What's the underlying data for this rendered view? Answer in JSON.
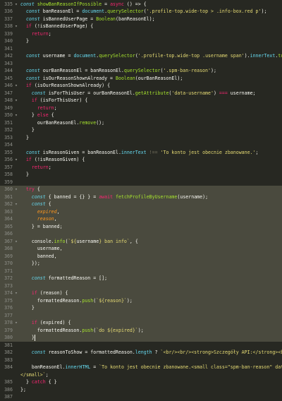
{
  "editor": {
    "theme_colors": {
      "background": "#272822",
      "highlight": "#4a4a3e",
      "keyword": "#f92672",
      "string": "#e6db74",
      "function": "#a6e22e",
      "property": "#66d9ef",
      "number": "#ae81ff",
      "comment": "#75715e"
    },
    "lines": [
      {
        "n": "335",
        "fold": "▾",
        "tokens": [
          [
            "t-dec",
            "const "
          ],
          [
            "t-fn",
            "showBanReasonIfPossible"
          ],
          [
            "t-punc",
            " = "
          ],
          [
            "t-kw",
            "async"
          ],
          [
            "t-punc",
            " () => {"
          ]
        ]
      },
      {
        "n": "336",
        "fold": "",
        "tokens": [
          [
            "t-dec",
            "  const "
          ],
          [
            "t-var",
            "banReasonEl"
          ],
          [
            "t-punc",
            " = "
          ],
          [
            "t-prop",
            "document"
          ],
          [
            "t-punc",
            "."
          ],
          [
            "t-fn",
            "querySelector"
          ],
          [
            "t-punc",
            "("
          ],
          [
            "t-str",
            "'.profile-top.wide-top > .info-box.red p'"
          ],
          [
            "t-punc",
            ");"
          ]
        ]
      },
      {
        "n": "337",
        "fold": "",
        "tokens": [
          [
            "t-dec",
            "  const "
          ],
          [
            "t-var",
            "isBannedUserPage"
          ],
          [
            "t-punc",
            " = "
          ],
          [
            "t-fn",
            "Boolean"
          ],
          [
            "t-punc",
            "(banReasonEl);"
          ]
        ]
      },
      {
        "n": "338",
        "fold": "▾",
        "tokens": [
          [
            "t-kw",
            "  if"
          ],
          [
            "t-punc",
            " (!isBannedUserPage) {"
          ]
        ]
      },
      {
        "n": "339",
        "fold": "",
        "tokens": [
          [
            "t-kw",
            "    return"
          ],
          [
            "t-punc",
            ";"
          ]
        ]
      },
      {
        "n": "340",
        "fold": "",
        "tokens": [
          [
            "t-punc",
            "  }"
          ]
        ]
      },
      {
        "n": "341",
        "fold": "",
        "tokens": []
      },
      {
        "n": "342",
        "fold": "",
        "tokens": [
          [
            "t-dec",
            "  const "
          ],
          [
            "t-var",
            "username"
          ],
          [
            "t-punc",
            " = "
          ],
          [
            "t-prop",
            "document"
          ],
          [
            "t-punc",
            "."
          ],
          [
            "t-fn",
            "querySelector"
          ],
          [
            "t-punc",
            "("
          ],
          [
            "t-str",
            "'.profile-top.wide-top .username span'"
          ],
          [
            "t-punc",
            ")."
          ],
          [
            "t-prop",
            "innerText"
          ],
          [
            "t-punc",
            "."
          ],
          [
            "t-fn",
            "trim"
          ],
          [
            "t-punc",
            "();"
          ]
        ]
      },
      {
        "n": "343",
        "fold": "",
        "tokens": []
      },
      {
        "n": "344",
        "fold": "",
        "tokens": [
          [
            "t-dec",
            "  const "
          ],
          [
            "t-var",
            "ourBanReasonEl"
          ],
          [
            "t-punc",
            " = banReasonEl."
          ],
          [
            "t-fn",
            "querySelector"
          ],
          [
            "t-punc",
            "("
          ],
          [
            "t-str",
            "'.spm-ban-reason'"
          ],
          [
            "t-punc",
            ");"
          ]
        ]
      },
      {
        "n": "345",
        "fold": "",
        "tokens": [
          [
            "t-dec",
            "  const "
          ],
          [
            "t-var",
            "isOurReasonShownAlready"
          ],
          [
            "t-punc",
            " = "
          ],
          [
            "t-fn",
            "Boolean"
          ],
          [
            "t-punc",
            "(ourBanReasonEl);"
          ]
        ]
      },
      {
        "n": "346",
        "fold": "▾",
        "tokens": [
          [
            "t-kw",
            "  if"
          ],
          [
            "t-punc",
            " (isOurReasonShownAlready) {"
          ]
        ]
      },
      {
        "n": "347",
        "fold": "",
        "tokens": [
          [
            "t-dec",
            "    const "
          ],
          [
            "t-var",
            "isForThisUser"
          ],
          [
            "t-punc",
            " = ourBanReasonEl."
          ],
          [
            "t-fn",
            "getAttribute"
          ],
          [
            "t-punc",
            "("
          ],
          [
            "t-str",
            "'data-username'"
          ],
          [
            "t-punc",
            ") "
          ],
          [
            "t-op",
            "==="
          ],
          [
            "t-punc",
            " username;"
          ]
        ]
      },
      {
        "n": "348",
        "fold": "▾",
        "tokens": [
          [
            "t-kw",
            "    if"
          ],
          [
            "t-punc",
            " (isForThisUser) {"
          ]
        ]
      },
      {
        "n": "349",
        "fold": "",
        "tokens": [
          [
            "t-kw",
            "      return"
          ],
          [
            "t-punc",
            ";"
          ]
        ]
      },
      {
        "n": "350",
        "fold": "▾",
        "tokens": [
          [
            "t-punc",
            "    } "
          ],
          [
            "t-kw",
            "else"
          ],
          [
            "t-punc",
            " {"
          ]
        ]
      },
      {
        "n": "351",
        "fold": "",
        "tokens": [
          [
            "t-punc",
            "      ourBanReasonEl."
          ],
          [
            "t-fn",
            "remove"
          ],
          [
            "t-punc",
            "();"
          ]
        ]
      },
      {
        "n": "352",
        "fold": "",
        "tokens": [
          [
            "t-punc",
            "    }"
          ]
        ]
      },
      {
        "n": "353",
        "fold": "",
        "tokens": [
          [
            "t-punc",
            "  }"
          ]
        ]
      },
      {
        "n": "354",
        "fold": "",
        "tokens": []
      },
      {
        "n": "355",
        "fold": "",
        "tokens": [
          [
            "t-dec",
            "  const "
          ],
          [
            "t-var",
            "isReasonGiven"
          ],
          [
            "t-punc",
            " = banReasonEl."
          ],
          [
            "t-prop",
            "innerText"
          ],
          [
            "t-punc",
            " "
          ],
          [
            "t-ghost",
            "!=="
          ],
          [
            "t-punc",
            " "
          ],
          [
            "t-str",
            "'To konto jest obecnie zbanowane.'"
          ],
          [
            "t-punc",
            ";"
          ]
        ]
      },
      {
        "n": "356",
        "fold": "▾",
        "tokens": [
          [
            "t-kw",
            "  if"
          ],
          [
            "t-punc",
            " (!isReasonGiven) {"
          ]
        ]
      },
      {
        "n": "357",
        "fold": "",
        "tokens": [
          [
            "t-kw",
            "    return"
          ],
          [
            "t-punc",
            ";"
          ]
        ]
      },
      {
        "n": "358",
        "fold": "",
        "tokens": [
          [
            "t-punc",
            "  }"
          ]
        ]
      },
      {
        "n": "359",
        "fold": "",
        "tokens": []
      },
      {
        "n": "360",
        "fold": "▾",
        "hl": true,
        "tokens": [
          [
            "t-kw",
            "  try"
          ],
          [
            "t-punc",
            " {"
          ]
        ]
      },
      {
        "n": "361",
        "fold": "",
        "hl": true,
        "tokens": [
          [
            "t-dec",
            "    const "
          ],
          [
            "t-punc",
            "{ "
          ],
          [
            "t-var",
            "banned"
          ],
          [
            "t-punc",
            " = {} } = "
          ],
          [
            "t-kw",
            "await"
          ],
          [
            "t-punc",
            " "
          ],
          [
            "t-fn",
            "fetchProfileByUsername"
          ],
          [
            "t-punc",
            "(username);"
          ]
        ]
      },
      {
        "n": "362",
        "fold": "▾",
        "hl": true,
        "tokens": [
          [
            "t-dec",
            "    const "
          ],
          [
            "t-punc",
            "{"
          ]
        ]
      },
      {
        "n": "363",
        "fold": "",
        "hl": true,
        "tokens": [
          [
            "t-param",
            "      expired"
          ],
          [
            "t-punc",
            ","
          ]
        ]
      },
      {
        "n": "364",
        "fold": "",
        "hl": true,
        "tokens": [
          [
            "t-param",
            "      reason"
          ],
          [
            "t-punc",
            ","
          ]
        ]
      },
      {
        "n": "365",
        "fold": "",
        "hl": true,
        "tokens": [
          [
            "t-punc",
            "    } = banned;"
          ]
        ]
      },
      {
        "n": "366",
        "fold": "",
        "hl": true,
        "tokens": []
      },
      {
        "n": "367",
        "fold": "▾",
        "hl": true,
        "tokens": [
          [
            "t-punc",
            "    console."
          ],
          [
            "t-fn",
            "info"
          ],
          [
            "t-punc",
            "("
          ],
          [
            "t-str",
            "`${"
          ],
          [
            "t-var",
            "username"
          ],
          [
            "t-str",
            "} ban info`"
          ],
          [
            "t-punc",
            ", {"
          ]
        ]
      },
      {
        "n": "368",
        "fold": "",
        "hl": true,
        "tokens": [
          [
            "t-punc",
            "      username,"
          ]
        ]
      },
      {
        "n": "369",
        "fold": "",
        "hl": true,
        "tokens": [
          [
            "t-punc",
            "      banned,"
          ]
        ]
      },
      {
        "n": "370",
        "fold": "",
        "hl": true,
        "tokens": [
          [
            "t-punc",
            "    });"
          ]
        ]
      },
      {
        "n": "371",
        "fold": "",
        "hl": true,
        "tokens": []
      },
      {
        "n": "372",
        "fold": "",
        "hl": true,
        "tokens": [
          [
            "t-dec",
            "    const "
          ],
          [
            "t-var",
            "formattedReason"
          ],
          [
            "t-punc",
            " = [];"
          ]
        ]
      },
      {
        "n": "373",
        "fold": "",
        "hl": true,
        "tokens": []
      },
      {
        "n": "374",
        "fold": "▾",
        "hl": true,
        "tokens": [
          [
            "t-kw",
            "    if"
          ],
          [
            "t-punc",
            " (reason) {"
          ]
        ]
      },
      {
        "n": "375",
        "fold": "",
        "hl": true,
        "tokens": [
          [
            "t-punc",
            "      formattedReason."
          ],
          [
            "t-fn",
            "push"
          ],
          [
            "t-punc",
            "("
          ],
          [
            "t-str",
            "`${reason}`"
          ],
          [
            "t-punc",
            ");"
          ]
        ]
      },
      {
        "n": "376",
        "fold": "",
        "hl": true,
        "tokens": [
          [
            "t-punc",
            "    }"
          ]
        ]
      },
      {
        "n": "377",
        "fold": "",
        "hl": true,
        "tokens": []
      },
      {
        "n": "378",
        "fold": "▾",
        "hl": true,
        "tokens": [
          [
            "t-kw",
            "    if"
          ],
          [
            "t-punc",
            " (expired) {"
          ]
        ]
      },
      {
        "n": "379",
        "fold": "",
        "hl": true,
        "tokens": [
          [
            "t-punc",
            "      formattedReason."
          ],
          [
            "t-fn",
            "push"
          ],
          [
            "t-punc",
            "("
          ],
          [
            "t-str",
            "`do ${expired}`"
          ],
          [
            "t-punc",
            ");"
          ]
        ]
      },
      {
        "n": "380",
        "fold": "",
        "hl": true,
        "cursor": true,
        "tokens": [
          [
            "t-punc",
            "    }"
          ]
        ]
      },
      {
        "n": "381",
        "fold": "",
        "tokens": []
      },
      {
        "n": "382",
        "fold": "",
        "tokens": [
          [
            "t-dec",
            "    const "
          ],
          [
            "t-var",
            "reasonToShow"
          ],
          [
            "t-punc",
            " = formattedReason."
          ],
          [
            "t-prop",
            "length"
          ],
          [
            "t-punc",
            " ? "
          ],
          [
            "t-str",
            "`<br/><br/><strong>Szczegóły API:</strong><br />${fo"
          ]
        ]
      },
      {
        "n": "383",
        "fold": "",
        "tokens": []
      },
      {
        "n": "384",
        "fold": "",
        "tokens": [
          [
            "t-punc",
            "    banReasonEl."
          ],
          [
            "t-prop",
            "innerHTML"
          ],
          [
            "t-punc",
            " = "
          ],
          [
            "t-str",
            "`To konto jest obecnie zbanowane.<small class=\"spm-ban-reason\" data-usern"
          ]
        ]
      },
      {
        "n": "",
        "fold": "",
        "tokens": [
          [
            "t-str",
            "</small>`"
          ],
          [
            "t-punc",
            ";"
          ]
        ]
      },
      {
        "n": "385",
        "fold": "",
        "tokens": [
          [
            "t-punc",
            "  } "
          ],
          [
            "t-kw",
            "catch"
          ],
          [
            "t-punc",
            " { }"
          ]
        ]
      },
      {
        "n": "386",
        "fold": "",
        "tokens": [
          [
            "t-punc",
            "};"
          ]
        ]
      },
      {
        "n": "387",
        "fold": "",
        "tokens": []
      }
    ]
  }
}
